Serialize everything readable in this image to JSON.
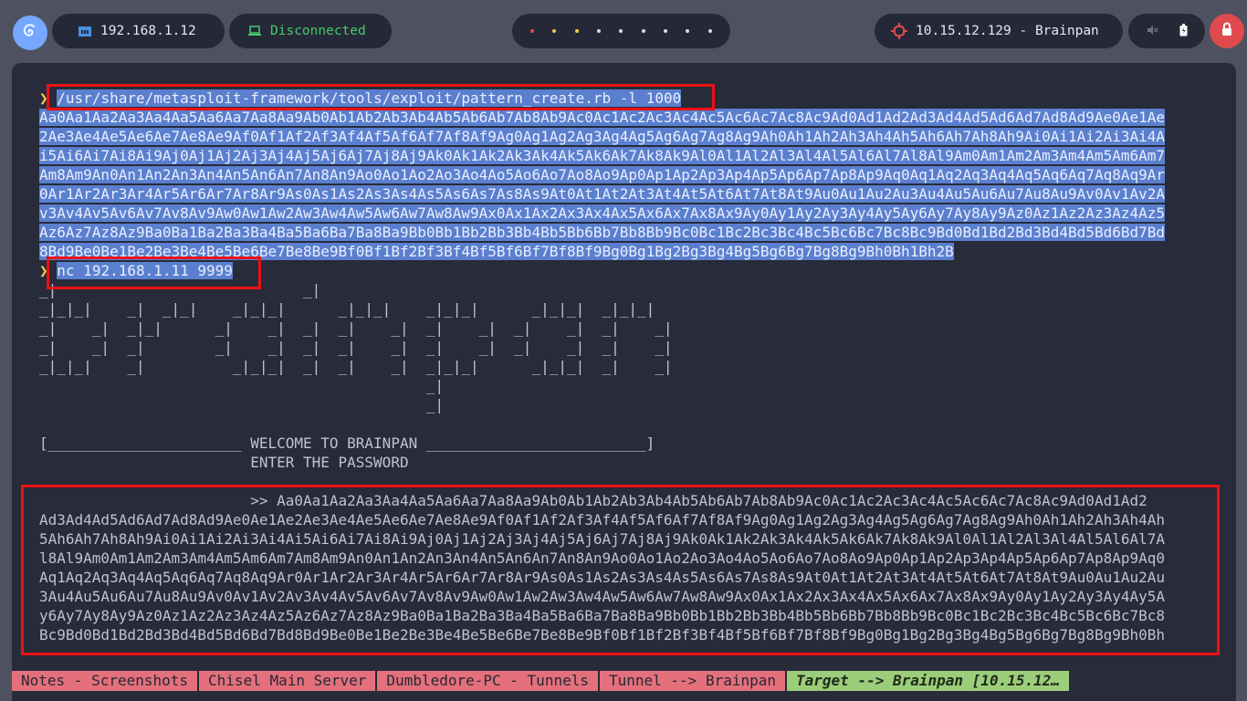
{
  "topbar": {
    "ip_label": "192.168.1.12",
    "vpn_label": "Disconnected",
    "workspace_dots": [
      "#e04a4e",
      "#f2c94c",
      "#f2c94c",
      "#d8dbe6",
      "#d8dbe6",
      "#d8dbe6",
      "#d8dbe6",
      "#d8dbe6",
      "#d8dbe6"
    ],
    "target_label": "10.15.12.129 - Brainpan",
    "icons": {
      "launcher": "debian-swirl-icon",
      "ip": "ethernet-icon",
      "vpn": "laptop-icon",
      "target": "crosshair-icon",
      "mute": "speaker-muted-icon",
      "battery": "battery-icon",
      "power": "power-icon"
    }
  },
  "terminal": {
    "prompt_symbol": "❯",
    "cmd1": "/usr/share/metasploit-framework/tools/exploit/pattern_create.rb -l 1000",
    "pattern_lines": [
      "Aa0Aa1Aa2Aa3Aa4Aa5Aa6Aa7Aa8Aa9Ab0Ab1Ab2Ab3Ab4Ab5Ab6Ab7Ab8Ab9Ac0Ac1Ac2Ac3Ac4Ac5Ac6Ac7Ac8Ac9Ad0Ad1Ad2Ad3Ad4Ad5Ad6Ad7Ad8Ad9Ae0Ae1Ae",
      "2Ae3Ae4Ae5Ae6Ae7Ae8Ae9Af0Af1Af2Af3Af4Af5Af6Af7Af8Af9Ag0Ag1Ag2Ag3Ag4Ag5Ag6Ag7Ag8Ag9Ah0Ah1Ah2Ah3Ah4Ah5Ah6Ah7Ah8Ah9Ai0Ai1Ai2Ai3Ai4A",
      "i5Ai6Ai7Ai8Ai9Aj0Aj1Aj2Aj3Aj4Aj5Aj6Aj7Aj8Aj9Ak0Ak1Ak2Ak3Ak4Ak5Ak6Ak7Ak8Ak9Al0Al1Al2Al3Al4Al5Al6Al7Al8Al9Am0Am1Am2Am3Am4Am5Am6Am7",
      "Am8Am9An0An1An2An3An4An5An6An7An8An9Ao0Ao1Ao2Ao3Ao4Ao5Ao6Ao7Ao8Ao9Ap0Ap1Ap2Ap3Ap4Ap5Ap6Ap7Ap8Ap9Aq0Aq1Aq2Aq3Aq4Aq5Aq6Aq7Aq8Aq9Ar",
      "0Ar1Ar2Ar3Ar4Ar5Ar6Ar7Ar8Ar9As0As1As2As3As4As5As6As7As8As9At0At1At2At3At4At5At6At7At8At9Au0Au1Au2Au3Au4Au5Au6Au7Au8Au9Av0Av1Av2A",
      "v3Av4Av5Av6Av7Av8Av9Aw0Aw1Aw2Aw3Aw4Aw5Aw6Aw7Aw8Aw9Ax0Ax1Ax2Ax3Ax4Ax5Ax6Ax7Ax8Ax9Ay0Ay1Ay2Ay3Ay4Ay5Ay6Ay7Ay8Ay9Az0Az1Az2Az3Az4Az5",
      "Az6Az7Az8Az9Ba0Ba1Ba2Ba3Ba4Ba5Ba6Ba7Ba8Ba9Bb0Bb1Bb2Bb3Bb4Bb5Bb6Bb7Bb8Bb9Bc0Bc1Bc2Bc3Bc4Bc5Bc6Bc7Bc8Bc9Bd0Bd1Bd2Bd3Bd4Bd5Bd6Bd7Bd",
      "8Bd9Be0Be1Be2Be3Be4Be5Be6Be7Be8Be9Bf0Bf1Bf2Bf3Bf4Bf5Bf6Bf7Bf8Bf9Bg0Bg1Bg2Bg3Bg4Bg5Bg6Bg7Bg8Bg9Bh0Bh1Bh2B"
    ],
    "cmd2": "nc 192.168.1.11 9999",
    "ascii_art": [
      "_|                            _|",
      "_|_|_|    _|  _|_|    _|_|_|      _|_|_|    _|_|_|      _|_|_|  _|_|_|",
      "_|    _|  _|_|      _|    _|  _|  _|    _|  _|    _|  _|    _|  _|    _|",
      "_|    _|  _|        _|    _|  _|  _|    _|  _|    _|  _|    _|  _|    _|",
      "_|_|_|    _|          _|_|_|  _|  _|    _|  _|_|_|      _|_|_|  _|    _|",
      "                                            _|",
      "                                            _|"
    ],
    "welcome": "[______________________ WELCOME TO BRAINPAN _________________________]",
    "enter_password": "                        ENTER THE PASSWORD",
    "response_lines": [
      "                        >> Aa0Aa1Aa2Aa3Aa4Aa5Aa6Aa7Aa8Aa9Ab0Ab1Ab2Ab3Ab4Ab5Ab6Ab7Ab8Ab9Ac0Ac1Ac2Ac3Ac4Ac5Ac6Ac7Ac8Ac9Ad0Ad1Ad2",
      "Ad3Ad4Ad5Ad6Ad7Ad8Ad9Ae0Ae1Ae2Ae3Ae4Ae5Ae6Ae7Ae8Ae9Af0Af1Af2Af3Af4Af5Af6Af7Af8Af9Ag0Ag1Ag2Ag3Ag4Ag5Ag6Ag7Ag8Ag9Ah0Ah1Ah2Ah3Ah4Ah",
      "5Ah6Ah7Ah8Ah9Ai0Ai1Ai2Ai3Ai4Ai5Ai6Ai7Ai8Ai9Aj0Aj1Aj2Aj3Aj4Aj5Aj6Aj7Aj8Aj9Ak0Ak1Ak2Ak3Ak4Ak5Ak6Ak7Ak8Ak9Al0Al1Al2Al3Al4Al5Al6Al7A",
      "l8Al9Am0Am1Am2Am3Am4Am5Am6Am7Am8Am9An0An1An2An3An4An5An6An7An8An9Ao0Ao1Ao2Ao3Ao4Ao5Ao6Ao7Ao8Ao9Ap0Ap1Ap2Ap3Ap4Ap5Ap6Ap7Ap8Ap9Aq0",
      "Aq1Aq2Aq3Aq4Aq5Aq6Aq7Aq8Aq9Ar0Ar1Ar2Ar3Ar4Ar5Ar6Ar7Ar8Ar9As0As1As2As3As4As5As6As7As8As9At0At1At2At3At4At5At6At7At8At9Au0Au1Au2Au",
      "3Au4Au5Au6Au7Au8Au9Av0Av1Av2Av3Av4Av5Av6Av7Av8Av9Aw0Aw1Aw2Aw3Aw4Aw5Aw6Aw7Aw8Aw9Ax0Ax1Ax2Ax3Ax4Ax5Ax6Ax7Ax8Ax9Ay0Ay1Ay2Ay3Ay4Ay5A",
      "y6Ay7Ay8Ay9Az0Az1Az2Az3Az4Az5Az6Az7Az8Az9Ba0Ba1Ba2Ba3Ba4Ba5Ba6Ba7Ba8Ba9Bb0Bb1Bb2Bb3Bb4Bb5Bb6Bb7Bb8Bb9Bc0Bc1Bc2Bc3Bc4Bc5Bc6Bc7Bc8",
      "Bc9Bd0Bd1Bd2Bd3Bd4Bd5Bd6Bd7Bd8Bd9Be0Be1Be2Be3Be4Be5Be6Be7Be8Be9Bf0Bf1Bf2Bf3Bf4Bf5Bf6Bf7Bf8Bf9Bg0Bg1Bg2Bg3Bg4Bg5Bg6Bg7Bg8Bg9Bh0Bh"
    ]
  },
  "statusbar": {
    "segments": [
      "Notes - Screenshots",
      "Chisel Main Server",
      "Dumbledore-PC - Tunnels",
      "Tunnel --> Brainpan",
      "Target --> Brainpan [10.15.12…"
    ]
  },
  "colors": {
    "highlight_box": "#ec1115",
    "selection": "#5a7fce",
    "prompt": "#f2d34b",
    "status_inactive": "#e4707c",
    "status_active": "#9ccd7a"
  }
}
